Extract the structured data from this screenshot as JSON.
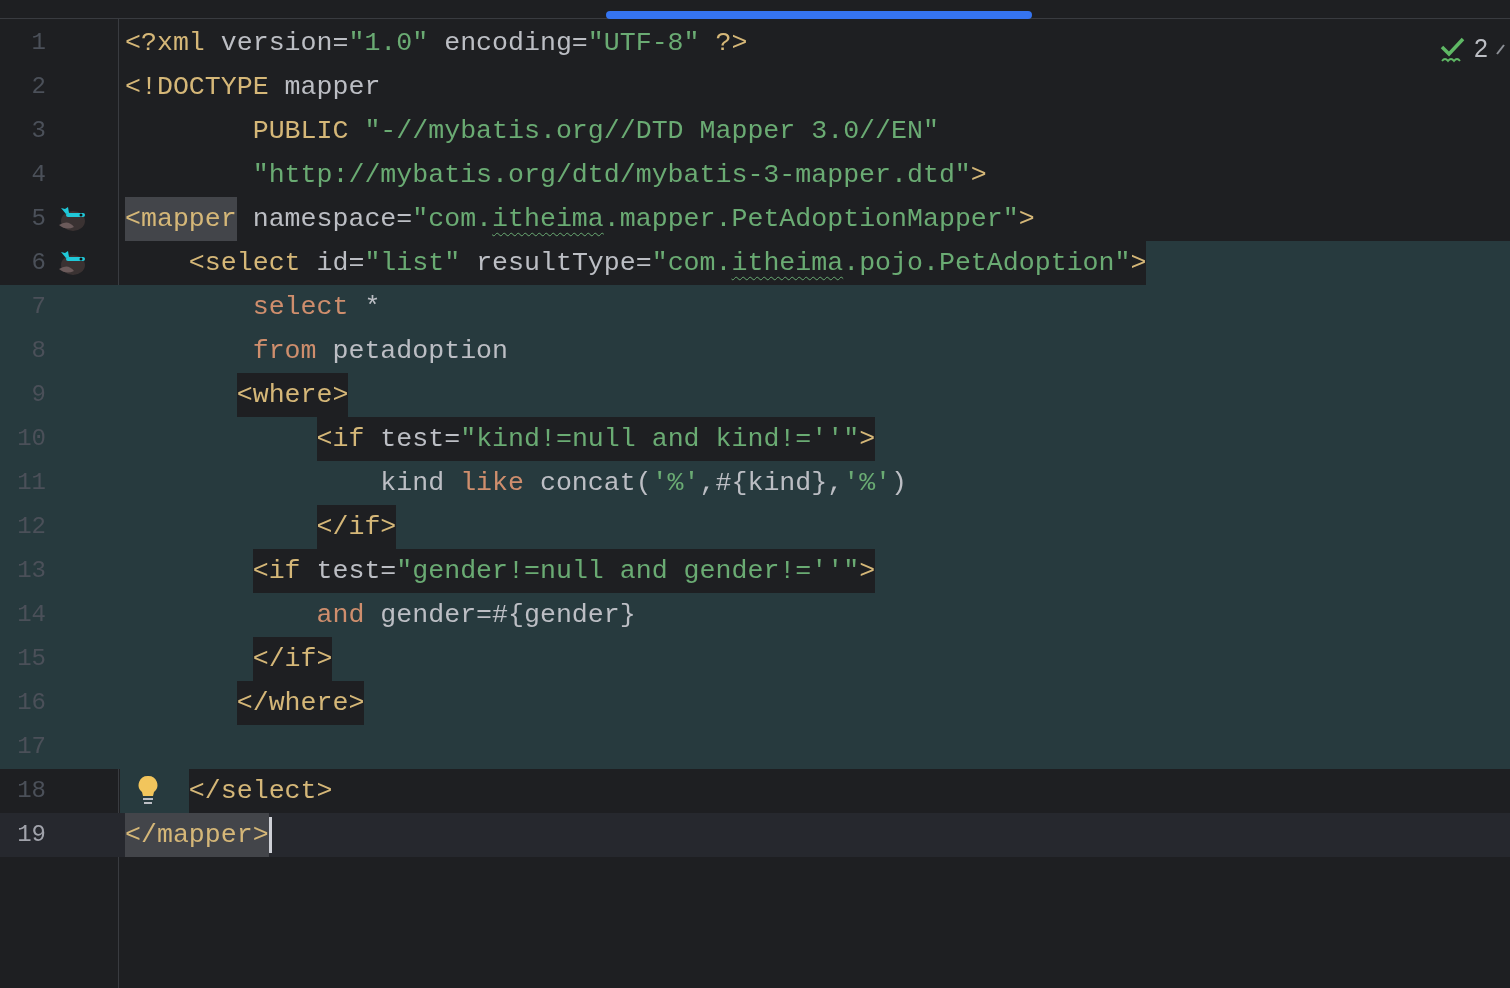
{
  "inspections": {
    "count": "2"
  },
  "lines": [
    {
      "number": "1",
      "kind": "plain",
      "tokens": [
        {
          "kind": "tag",
          "text": "<?xml"
        },
        {
          "kind": "attr",
          "text": " version="
        },
        {
          "kind": "str",
          "text": "\"1.0\""
        },
        {
          "kind": "attr",
          "text": " encoding="
        },
        {
          "kind": "str",
          "text": "\"UTF-8\""
        },
        {
          "kind": "tag",
          "text": " ?>"
        }
      ]
    },
    {
      "number": "2",
      "kind": "plain",
      "tokens": [
        {
          "kind": "tag",
          "text": "<!DOCTYPE"
        },
        {
          "kind": "plain",
          "text": " mapper"
        }
      ]
    },
    {
      "number": "3",
      "kind": "plain",
      "tokens": [
        {
          "kind": "tag",
          "text": "        PUBLIC"
        },
        {
          "kind": "str",
          "text": " \"-//mybatis.org//DTD Mapper 3.0//EN\""
        }
      ]
    },
    {
      "number": "4",
      "kind": "plain",
      "tokens": [
        {
          "kind": "str",
          "text": "        \"http://mybatis.org/dtd/mybatis-3-mapper.dtd\""
        },
        {
          "kind": "tag",
          "text": ">"
        }
      ]
    },
    {
      "number": "5",
      "kind": "plain",
      "mapper_marker": true,
      "tokens": [
        {
          "kind": "tag",
          "text": "<mapper",
          "matched": true
        },
        {
          "kind": "attr",
          "text": " namespace="
        },
        {
          "kind": "str",
          "text": "\"com."
        },
        {
          "kind": "str",
          "text": "itheima",
          "typo": true
        },
        {
          "kind": "str",
          "text": ".mapper.PetAdoptionMapper\""
        },
        {
          "kind": "tag",
          "text": ">"
        }
      ]
    },
    {
      "number": "6",
      "kind": "scope-tail",
      "mapper_marker": true,
      "tokens": [
        {
          "kind": "tag",
          "text": "    <select"
        },
        {
          "kind": "attr",
          "text": " id="
        },
        {
          "kind": "str",
          "text": "\"list\""
        },
        {
          "kind": "attr",
          "text": " resultType="
        },
        {
          "kind": "str",
          "text": "\"com."
        },
        {
          "kind": "str",
          "text": "itheima",
          "typo": true
        },
        {
          "kind": "str",
          "text": ".pojo.PetAdoption\""
        },
        {
          "kind": "tag",
          "text": ">"
        }
      ]
    },
    {
      "number": "7",
      "kind": "scope",
      "tokens": [
        {
          "kind": "keyword",
          "text": "        select"
        },
        {
          "kind": "plain",
          "text": " *"
        }
      ]
    },
    {
      "number": "8",
      "kind": "scope",
      "tokens": [
        {
          "kind": "keyword",
          "text": "        from"
        },
        {
          "kind": "plain",
          "text": " petadoption"
        }
      ]
    },
    {
      "number": "9",
      "kind": "scope",
      "tokens": [
        {
          "kind": "tag",
          "text": "       <where>",
          "boxed": true
        }
      ]
    },
    {
      "number": "10",
      "kind": "scope",
      "tokens": [
        {
          "kind": "tag",
          "text": "            <if",
          "boxed": true
        },
        {
          "kind": "attr",
          "text": " test=",
          "boxed": true
        },
        {
          "kind": "str",
          "text": "\"kind!=null and kind!=''\"",
          "boxed": true
        },
        {
          "kind": "tag",
          "text": ">",
          "boxed": true
        }
      ]
    },
    {
      "number": "11",
      "kind": "scope",
      "tokens": [
        {
          "kind": "plain",
          "text": "                kind"
        },
        {
          "kind": "keyword",
          "text": " like"
        },
        {
          "kind": "plain",
          "text": " concat("
        },
        {
          "kind": "str",
          "text": "'%'"
        },
        {
          "kind": "plain",
          "text": ",#{kind},"
        },
        {
          "kind": "str",
          "text": "'%'"
        },
        {
          "kind": "plain",
          "text": ")"
        }
      ]
    },
    {
      "number": "12",
      "kind": "scope",
      "tokens": [
        {
          "kind": "tag",
          "text": "            </if>",
          "boxed": true
        }
      ]
    },
    {
      "number": "13",
      "kind": "scope",
      "tokens": [
        {
          "kind": "tag",
          "text": "        <if",
          "boxed": true
        },
        {
          "kind": "attr",
          "text": " test=",
          "boxed": true
        },
        {
          "kind": "str",
          "text": "\"gender!=null and gender!=''\"",
          "boxed": true
        },
        {
          "kind": "tag",
          "text": ">",
          "boxed": true
        }
      ]
    },
    {
      "number": "14",
      "kind": "scope",
      "tokens": [
        {
          "kind": "keyword",
          "text": "            and"
        },
        {
          "kind": "plain",
          "text": " gender=#{gender}"
        }
      ]
    },
    {
      "number": "15",
      "kind": "scope",
      "tokens": [
        {
          "kind": "tag",
          "text": "        </if>",
          "boxed": true
        }
      ]
    },
    {
      "number": "16",
      "kind": "scope",
      "tokens": [
        {
          "kind": "tag",
          "text": "       </where>",
          "boxed": true
        }
      ]
    },
    {
      "number": "17",
      "kind": "scope"
    },
    {
      "number": "18",
      "kind": "scope-head",
      "bulb": true,
      "tokens": [
        {
          "kind": "tag",
          "text": "    </select>"
        }
      ]
    },
    {
      "number": "19",
      "kind": "plain",
      "current": true,
      "caret": true,
      "tokens": [
        {
          "kind": "tag",
          "text": "</mapper>",
          "matched": true
        }
      ]
    }
  ]
}
